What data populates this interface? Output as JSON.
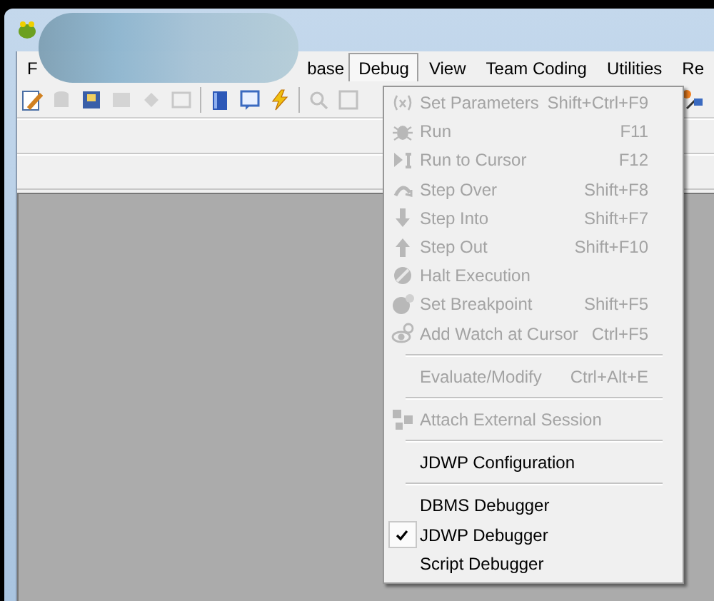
{
  "menu_bar": [
    {
      "label": "F",
      "selected": false
    },
    {
      "label": "base",
      "selected": false
    },
    {
      "label": "Debug",
      "selected": true
    },
    {
      "label": "View",
      "selected": false
    },
    {
      "label": "Team Coding",
      "selected": false
    },
    {
      "label": "Utilities",
      "selected": false
    },
    {
      "label": "Re",
      "selected": false
    }
  ],
  "debug_menu": [
    {
      "kind": "item",
      "label": "Set Parameters",
      "shortcut": "Shift+Ctrl+F9",
      "disabled": true,
      "checked": false
    },
    {
      "kind": "item",
      "label": "Run",
      "shortcut": "F11",
      "disabled": true,
      "checked": false
    },
    {
      "kind": "item",
      "label": "Run to Cursor",
      "shortcut": "F12",
      "disabled": true,
      "checked": false
    },
    {
      "kind": "item",
      "label": "Step Over",
      "shortcut": "Shift+F8",
      "disabled": true,
      "checked": false
    },
    {
      "kind": "item",
      "label": "Step Into",
      "shortcut": "Shift+F7",
      "disabled": true,
      "checked": false
    },
    {
      "kind": "item",
      "label": "Step Out",
      "shortcut": "Shift+F10",
      "disabled": true,
      "checked": false
    },
    {
      "kind": "item",
      "label": "Halt Execution",
      "disabled": true,
      "checked": false
    },
    {
      "kind": "item",
      "label": "Set Breakpoint",
      "shortcut": "Shift+F5",
      "disabled": true,
      "checked": false
    },
    {
      "kind": "item",
      "label": "Add Watch at Cursor",
      "shortcut": "Ctrl+F5",
      "disabled": true,
      "checked": false
    },
    {
      "kind": "separator"
    },
    {
      "kind": "item",
      "label": "Evaluate/Modify",
      "shortcut": "Ctrl+Alt+E",
      "disabled": true,
      "checked": false
    },
    {
      "kind": "separator"
    },
    {
      "kind": "item",
      "label": "Attach External Session",
      "disabled": true,
      "checked": false
    },
    {
      "kind": "separator"
    },
    {
      "kind": "item",
      "label": "JDWP Configuration",
      "disabled": false,
      "checked": false
    },
    {
      "kind": "separator"
    },
    {
      "kind": "item",
      "label": "DBMS Debugger",
      "disabled": false,
      "checked": false
    },
    {
      "kind": "item",
      "label": "JDWP Debugger",
      "disabled": false,
      "checked": true
    },
    {
      "kind": "item",
      "label": "Script Debugger",
      "disabled": false,
      "checked": false
    }
  ]
}
